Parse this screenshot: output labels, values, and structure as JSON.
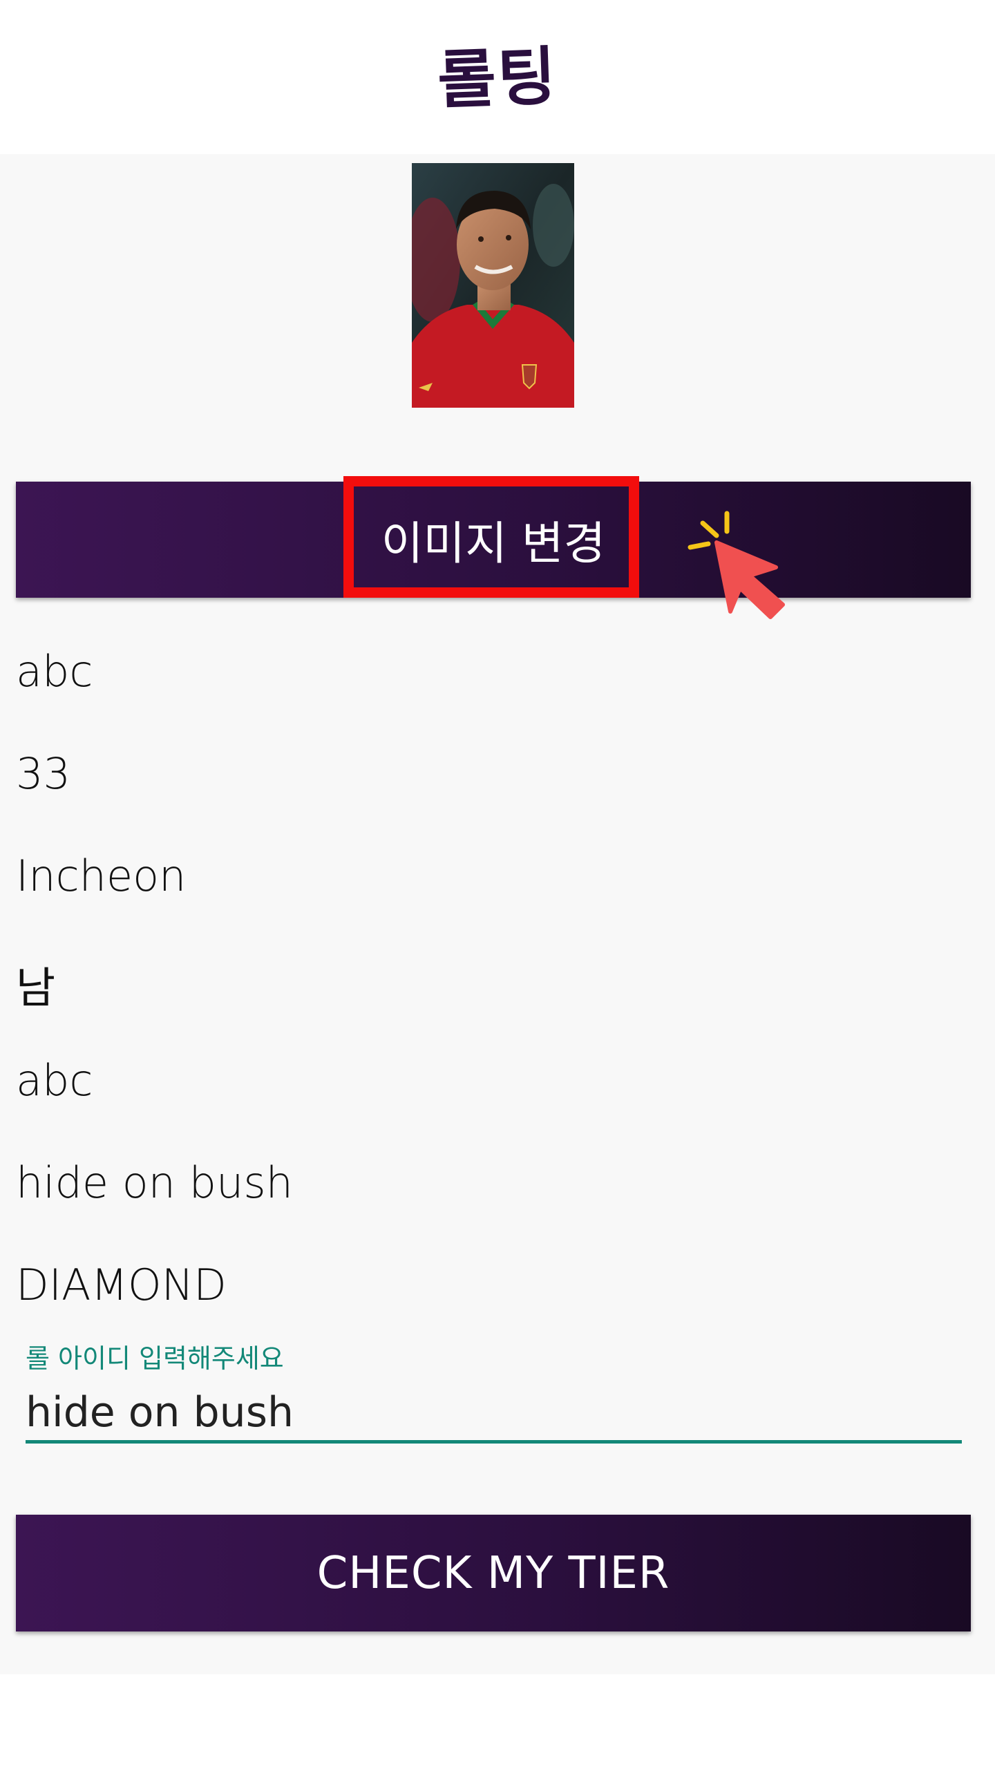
{
  "header": {
    "app_title": "롤팅"
  },
  "profile": {
    "photo_alt": "profile photo",
    "change_image_label": "이미지 변경"
  },
  "info_list": [
    "abc",
    "33",
    "Incheon",
    "남",
    "abc",
    "hide on bush",
    "DIAMOND"
  ],
  "tier_form": {
    "field_label": "롤 아이디 입력해주세요",
    "input_value": "hide on bush",
    "submit_label": "CHECK MY TIER"
  },
  "colors": {
    "accent": "#138878",
    "button_gradient_start": "#3c1553",
    "button_gradient_end": "#190a24",
    "highlight": "#f20d0d",
    "cursor": "#f05050",
    "sparkle": "#f5c518"
  },
  "icons": {
    "cursor_overlay": "hand-pointer-click-icon"
  }
}
